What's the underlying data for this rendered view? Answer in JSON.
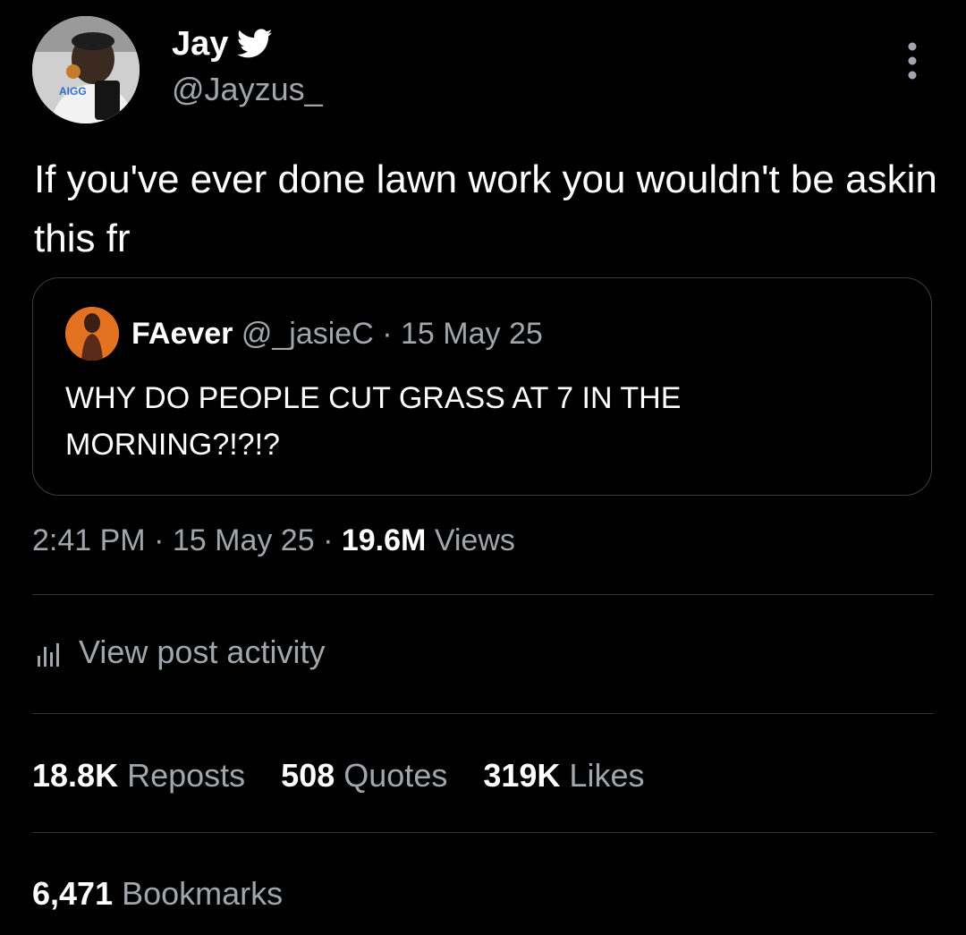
{
  "author": {
    "display_name": "Jay",
    "verified_icon": "twitter-bird-icon",
    "handle": "@Jayzus_",
    "avatar_text": "AIGG"
  },
  "tweet": {
    "text": "If you've ever done lawn work you wouldn't be askin this fr"
  },
  "quoted_tweet": {
    "display_name": "FAever",
    "handle": "@_jasieC",
    "separator": "·",
    "date": "15 May 25",
    "text": "WHY DO PEOPLE CUT GRASS AT 7 IN THE MORNING?!?!?"
  },
  "meta": {
    "time": "2:41 PM",
    "separator": "·",
    "date": "15 May 25",
    "views_count": "19.6M",
    "views_label": "Views"
  },
  "activity": {
    "icon": "bar-chart-icon",
    "label": "View post activity"
  },
  "stats": {
    "reposts_count": "18.8K",
    "reposts_label": "Reposts",
    "quotes_count": "508",
    "quotes_label": "Quotes",
    "likes_count": "319K",
    "likes_label": "Likes",
    "bookmarks_count": "6,471",
    "bookmarks_label": "Bookmarks"
  },
  "colors": {
    "background": "#000000",
    "primary_text": "#ffffff",
    "secondary_text": "#a0a6ab",
    "divider": "#2f3336"
  }
}
